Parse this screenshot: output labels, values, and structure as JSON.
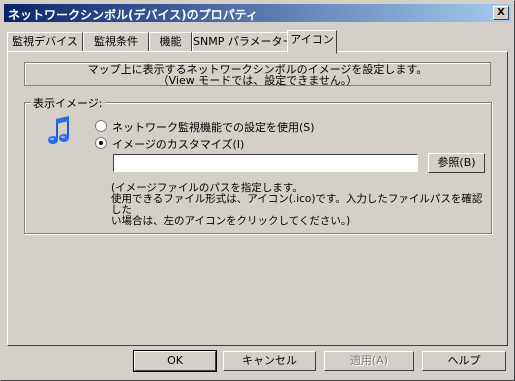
{
  "window": {
    "title": "ネットワークシンボル(デバイス)のプロパティ",
    "close_label": "X"
  },
  "tabs": [
    {
      "label": "監視デバイス"
    },
    {
      "label": "監視条件"
    },
    {
      "label": "機能"
    },
    {
      "label": "SNMP パラメーター"
    },
    {
      "label": "アイコン"
    }
  ],
  "active_tab": "アイコン",
  "info": {
    "line1": "マップ上に表示するネットワークシンボルのイメージを設定します。",
    "line2": "（View モードでは、設定できません。）"
  },
  "display_group": {
    "label": "表示イメージ:",
    "icon": "music-note-icon",
    "radio_default": "ネットワーク監視機能での設定を使用(S)",
    "radio_custom": "イメージのカスタマイズ(I)",
    "selected": "custom",
    "path_value": "",
    "browse_label": "参照(B)",
    "help_line1": "(イメージファイルのパスを指定します。",
    "help_line2": "使用できるファイル形式は、アイコン(.ico)です。入力したファイルパスを確認した",
    "help_line3": "い場合は、左のアイコンをクリックしてください。)"
  },
  "footer": {
    "ok": "OK",
    "cancel": "キャンセル",
    "apply": "適用(A)",
    "help": "ヘルプ"
  }
}
